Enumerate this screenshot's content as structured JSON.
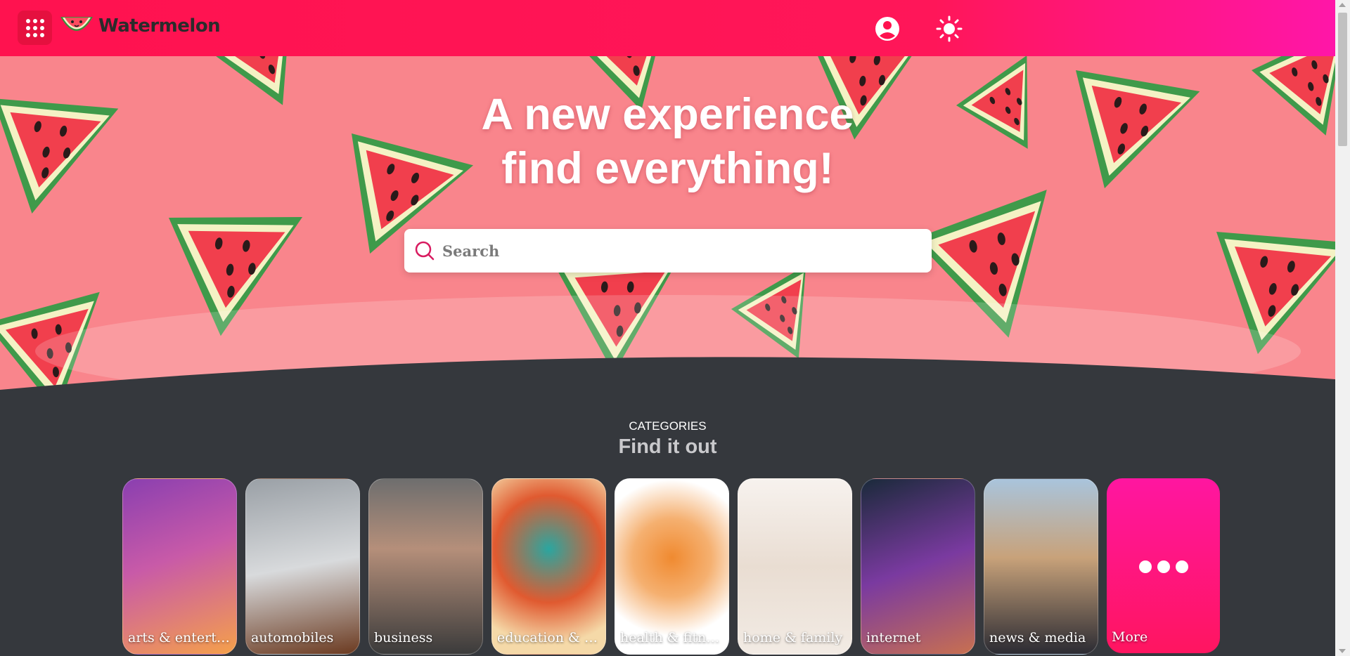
{
  "header": {
    "brand": "Watermelon",
    "apps_icon": "apps-grid-icon",
    "account_icon": "account-circle-icon",
    "theme_icon": "sun-icon",
    "brand_color": "#ff124f"
  },
  "hero": {
    "title_line1": "A new experience",
    "title_line2": "find everything!",
    "search_placeholder": "Search",
    "search_icon": "search-icon"
  },
  "categories": {
    "eyebrow": "CATEGORIES",
    "title": "Find it out",
    "items": [
      {
        "label": "arts & entertai..."
      },
      {
        "label": "automobiles"
      },
      {
        "label": "business"
      },
      {
        "label": "education & sci..."
      },
      {
        "label": "health & fitnes..."
      },
      {
        "label": "home & family"
      },
      {
        "label": "internet"
      },
      {
        "label": "news & media"
      },
      {
        "label": "More"
      }
    ]
  }
}
